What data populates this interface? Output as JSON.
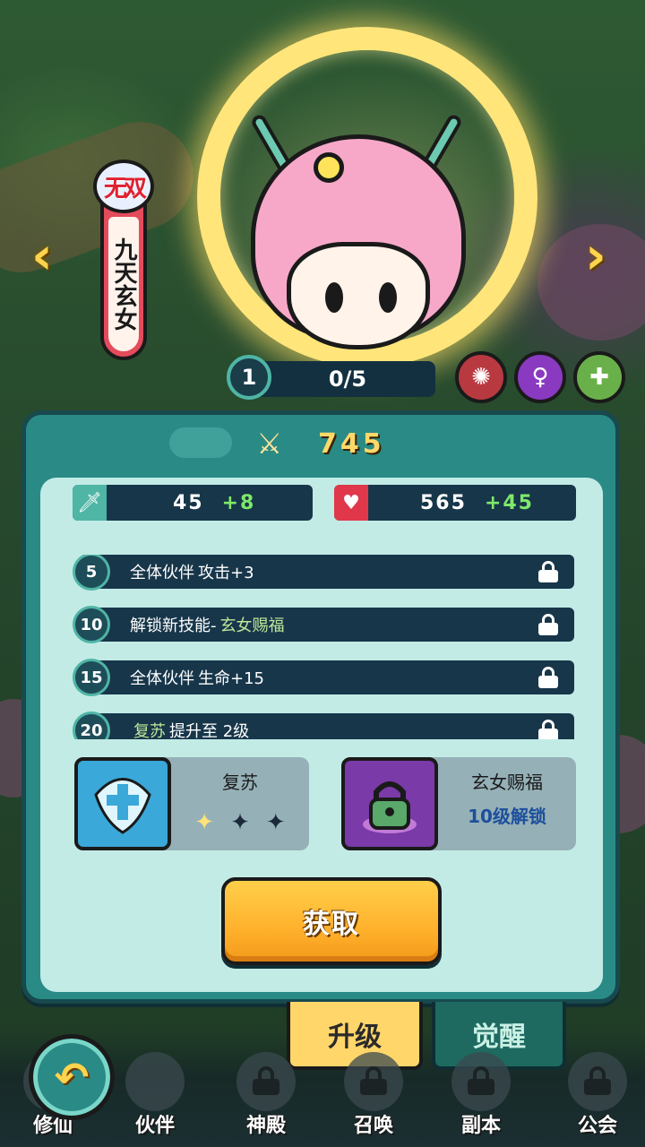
{
  "hero": {
    "rarity": "无双",
    "name": "九天玄女",
    "level": "1",
    "stars_progress": "0/5"
  },
  "panel": {
    "power": "745",
    "attack": {
      "base": "45",
      "bonus": "+8"
    },
    "hp": {
      "base": "565",
      "bonus": "+45"
    },
    "bonuses": [
      {
        "level": "5",
        "prefix": "全体伙伴",
        "highlight": "攻击+3",
        "suffix": "",
        "hl_color": "#ffffff",
        "locked": true
      },
      {
        "level": "10",
        "prefix": "解锁新技能-",
        "highlight": "玄女赐福",
        "suffix": "",
        "hl_color": "#bfe79a",
        "locked": true
      },
      {
        "level": "15",
        "prefix": "全体伙伴",
        "highlight": "生命+15",
        "suffix": "",
        "hl_color": "#ffffff",
        "locked": true
      },
      {
        "level": "20",
        "prefix": "",
        "highlight": "复苏",
        "suffix": "提升至 2级",
        "hl_color": "#bfe79a",
        "locked": true
      }
    ],
    "skills": [
      {
        "name": "复苏",
        "star_count": 1,
        "star_total": 3
      },
      {
        "name": "玄女赐福",
        "unlock_text": "10级解锁"
      }
    ],
    "get_button": "获取"
  },
  "tabs": {
    "upgrade": "升级",
    "awaken": "觉醒"
  },
  "bottom_nav": [
    {
      "label": "修仙",
      "locked": false,
      "icon": "cultivate-icon"
    },
    {
      "label": "伙伴",
      "locked": false,
      "icon": "partner-icon"
    },
    {
      "label": "神殿",
      "locked": true,
      "icon": "temple-icon"
    },
    {
      "label": "召唤",
      "locked": true,
      "icon": "summon-icon"
    },
    {
      "label": "副本",
      "locked": true,
      "icon": "dungeon-icon"
    },
    {
      "label": "公会",
      "locked": true,
      "icon": "guild-icon"
    }
  ],
  "colors": {
    "accent_teal": "#2a8a86",
    "gold": "#ffd34d",
    "bonus_green": "#7fe86a",
    "unlock_blue": "#1d4f9c"
  }
}
